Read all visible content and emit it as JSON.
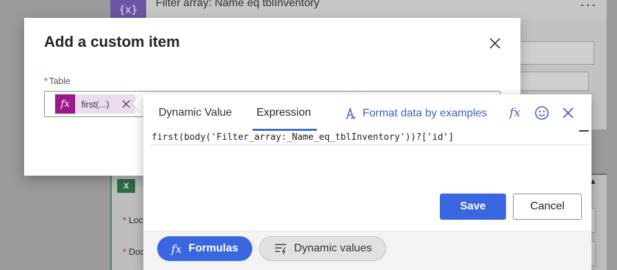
{
  "background": {
    "flow_step_title": "Filter array: Name eq tblInventory",
    "flow_step_icon": "{x}",
    "excel_icon": "X",
    "field_labels": [
      "Loc",
      "Doc"
    ]
  },
  "dialog": {
    "title": "Add a custom item",
    "table_label": "Table",
    "token_label": "first(...)"
  },
  "popup": {
    "tabs": {
      "dynamic": "Dynamic Value",
      "expression": "Expression"
    },
    "format_label": "Format data by examples",
    "expression": "first(body('Filter_array:_Name_eq_tblInventory'))?['id']",
    "save_label": "Save",
    "cancel_label": "Cancel",
    "footer": {
      "formulas": "Formulas",
      "dynamic_values": "Dynamic values"
    }
  },
  "colors": {
    "accent": "#3a66e0",
    "fx_token": "#9a198a",
    "required": "#a4262c"
  }
}
